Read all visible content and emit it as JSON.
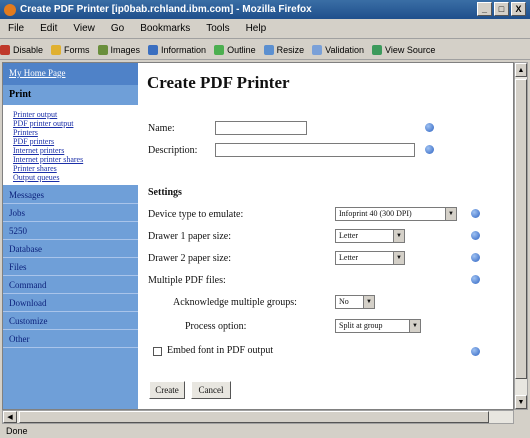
{
  "window": {
    "title": "Create PDF Printer [ip0bab.rchland.ibm.com] - Mozilla Firefox",
    "controls": [
      "_",
      "□",
      "X"
    ]
  },
  "menu": [
    "File",
    "Edit",
    "View",
    "Go",
    "Bookmarks",
    "Tools",
    "Help"
  ],
  "toolbar": [
    "Disable",
    "Forms",
    "Images",
    "Information",
    "Outline",
    "Resize",
    "Validation",
    "View Source"
  ],
  "sidebar": {
    "home": "My Home Page",
    "section": "Print",
    "subitems": [
      "Printer output",
      "PDF printer output",
      "Printers",
      "PDF printers",
      "Internet printers",
      "Internet printer shares",
      "Printer shares",
      "Output queues"
    ],
    "items": [
      "Messages",
      "Jobs",
      "5250",
      "Database",
      "Files",
      "Command",
      "Download",
      "Customize",
      "Other"
    ]
  },
  "page": {
    "title": "Create PDF Printer",
    "name_label": "Name:",
    "description_label": "Description:",
    "name_value": "",
    "description_value": "",
    "settings_heading": "Settings",
    "device_label": "Device type to emulate:",
    "device_value": "Infoprint 40 (300 DPI)",
    "drawer1_label": "Drawer 1 paper size:",
    "drawer1_value": "Letter",
    "drawer2_label": "Drawer 2 paper size:",
    "drawer2_value": "Letter",
    "multiple_label": "Multiple PDF files:",
    "ack_label": "Acknowledge multiple groups:",
    "ack_value": "No",
    "process_label": "Process option:",
    "process_value": "Split at group",
    "embed_label": "Embed font in PDF output",
    "embed_checked": false,
    "create_button": "Create",
    "cancel_button": "Cancel"
  },
  "status": "Done",
  "colors": {
    "sidebar": "#6f9fd8",
    "sidebar_home": "#4f82c8",
    "help_icon": "#2e63c2",
    "titlebar": "#1f4f8c"
  }
}
